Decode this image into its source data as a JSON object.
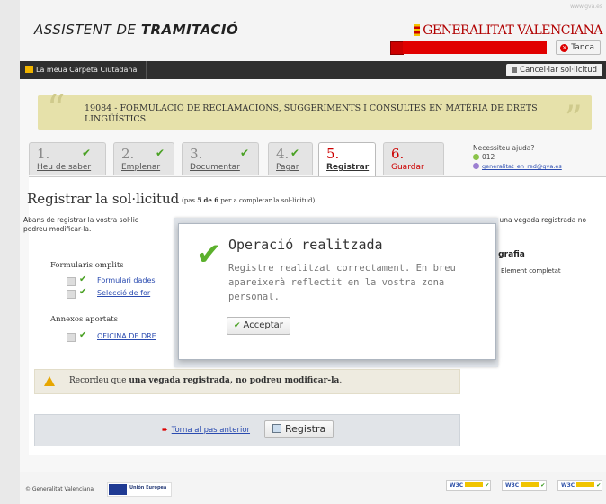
{
  "header": {
    "brand_prefix": "ASSISTENT DE ",
    "brand_bold": "TRAMITACIÓ",
    "gva_url": "www.gva.es",
    "logo_text": "GENERALITAT VALENCIANA",
    "close_label": "Tanca"
  },
  "navbar": {
    "carpeta_label": "La meua Carpeta Ciutadana",
    "cancel_label": "Cancel·lar sol·licitud"
  },
  "banner": {
    "title": "19084 - FORMULACIÓ DE RECLAMACIONS, SUGGERIMENTS I CONSULTES EN MATÈRIA DE DRETS LINGÜÍSTICS."
  },
  "steps": [
    {
      "num": "1.",
      "label": "Heu de saber",
      "done": true
    },
    {
      "num": "2.",
      "label": "Emplenar",
      "done": true
    },
    {
      "num": "3.",
      "label": "Documentar",
      "done": true
    },
    {
      "num": "4.",
      "label": "Pagar",
      "done": true
    },
    {
      "num": "5.",
      "label": "Registrar",
      "done": false
    },
    {
      "num": "6.",
      "label": "Guardar",
      "done": false
    }
  ],
  "help": {
    "title": "Necessiteu ajuda?",
    "phone": "012",
    "email": "generalitat_en_red@gva.es"
  },
  "main": {
    "title": "Registrar la sol·licitud",
    "subtitle_pre": "(pas ",
    "subtitle_bold": "5 de 6",
    "subtitle_post": " per a completar la sol·licitud)",
    "intro_left": "Abans de registrar la vostra sol·lic",
    "intro_right": "que una vegada registrada no",
    "intro_line2": "podreu modificar-la.",
    "forms_heading": "Formularis omplits",
    "form_items": [
      "Formulari dades",
      "Selecció de for"
    ],
    "annex_heading": "Annexos aportats",
    "annex_items": [
      "OFICINA DE DRE"
    ],
    "legend_heading": "ografia",
    "legend_item": "Element completat",
    "warning_pre": "Recordeu que ",
    "warning_bold": "una vegada registrada, no podreu modificar-la",
    "warning_post": ".",
    "back_link": "Torna al pas anterior",
    "register_button": "Registra"
  },
  "dialog": {
    "title": "Operació realitzada",
    "message": "Registre realitzat correctament. En breu apareixerà reflectit en la vostra zona personal.",
    "accept_label": "Acceptar"
  },
  "footer": {
    "copyright": "© Generalitat Valenciana",
    "eu_label": "Unión Europea",
    "badges": [
      "W3C",
      "W3C",
      "W3C"
    ]
  }
}
